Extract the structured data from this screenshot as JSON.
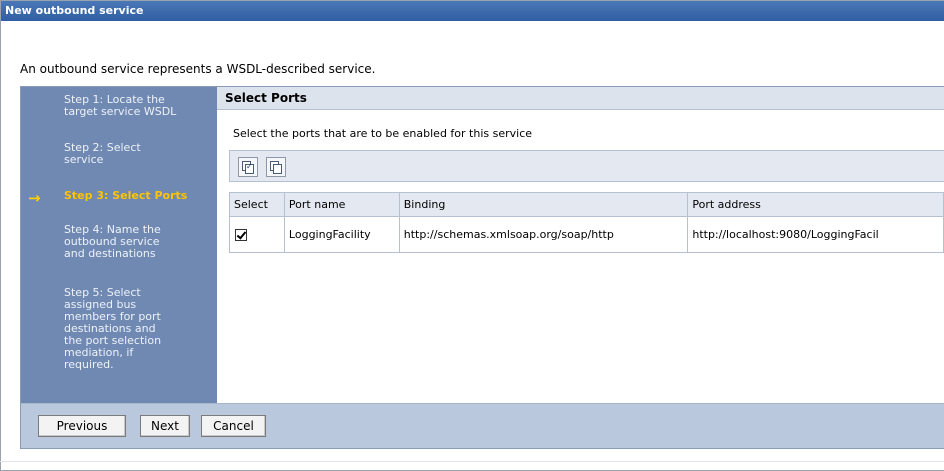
{
  "window": {
    "title": "New outbound service"
  },
  "intro_text": "An outbound service represents a WSDL-described service.",
  "steps": [
    {
      "label": "Step 1: Locate the target service WSDL",
      "lines": [
        "Step 1: Locate the",
        "target service WSDL"
      ],
      "current": false
    },
    {
      "label": "Step 2: Select service",
      "lines": [
        "Step 2: Select",
        "service"
      ],
      "current": false
    },
    {
      "label": "Step 3: Select Ports",
      "lines": [
        "Step 3: Select Ports"
      ],
      "current": true
    },
    {
      "label": "Step 4: Name the outbound service and destinations",
      "lines": [
        "Step 4: Name the",
        "outbound service",
        "and destinations"
      ],
      "current": false
    },
    {
      "label": "Step 5: Select assigned bus members for port destinations and the port selection mediation, if required.",
      "lines": [
        "Step 5: Select",
        "assigned bus",
        "members for port",
        "destinations and",
        "the port selection",
        "mediation, if",
        "required."
      ],
      "current": false
    }
  ],
  "current_step_arrow": "→",
  "panel": {
    "title": "Select Ports",
    "description": "Select the ports that are to be enabled for this service"
  },
  "toolbar": {
    "buttons": [
      {
        "name": "select-all-icon",
        "tooltip": ""
      },
      {
        "name": "deselect-all-icon",
        "tooltip": ""
      }
    ]
  },
  "table": {
    "headers": [
      "Select",
      "Port name",
      "Binding",
      "Port address"
    ],
    "rows": [
      {
        "selected": true,
        "port_name": "LoggingFacility",
        "binding": "http://schemas.xmlsoap.org/soap/http",
        "port_address": "http://localhost:9080/LoggingFacil"
      }
    ]
  },
  "buttons": {
    "previous": "Previous",
    "next": "Next",
    "cancel": "Cancel"
  },
  "colors": {
    "title_bar": "#2f5fa3",
    "steps_bg": "#6f89b3",
    "current_step": "#ffc400",
    "button_bar": "#b9c8dc"
  }
}
